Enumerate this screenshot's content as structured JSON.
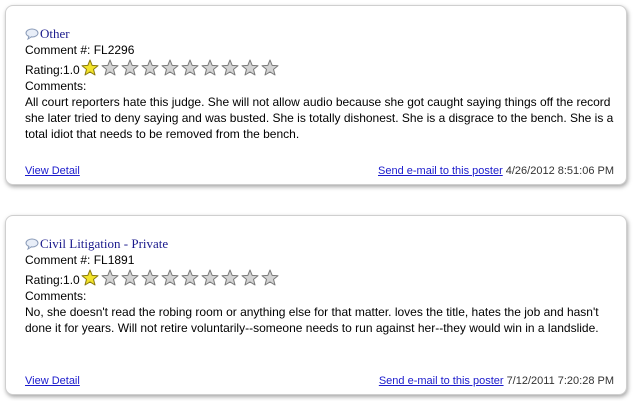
{
  "reviews": [
    {
      "category": "Other",
      "comment_label": "Comment #:",
      "comment_id": "FL2296",
      "rating_label": "Rating:",
      "rating_value": "1.0",
      "stars_filled": 1,
      "stars_total": 10,
      "comments_label": "Comments:",
      "comment_text": "All court reporters hate this judge. She will not allow audio because she got caught saying things off the record she later tried to deny saying and was busted. She is totally dishonest. She is a disgrace to the bench. She is a total idiot that needs to be removed from the bench.",
      "view_detail": "View Detail",
      "send_email": "Send e-mail to this poster",
      "timestamp": "4/26/2012 8:51:06 PM"
    },
    {
      "category": "Civil Litigation - Private",
      "comment_label": "Comment #:",
      "comment_id": "FL1891",
      "rating_label": "Rating:",
      "rating_value": "1.0",
      "stars_filled": 1,
      "stars_total": 10,
      "comments_label": "Comments:",
      "comment_text": "No, she doesn't read the robing room or anything else for that matter. loves the title, hates the job and hasn't done it for years. Will not retire voluntarily--someone needs to run against her--they would win in a landslide.",
      "view_detail": "View Detail",
      "send_email": "Send e-mail to this poster",
      "timestamp": "7/12/2011 7:20:28 PM"
    }
  ],
  "colors": {
    "star_filled": "#f2e32a",
    "star_empty": "#d4d4d4",
    "link": "#1a1acc",
    "category": "#1a1a8c"
  },
  "icons": {
    "category": "speech-bubble-icon",
    "star": "star-icon"
  }
}
